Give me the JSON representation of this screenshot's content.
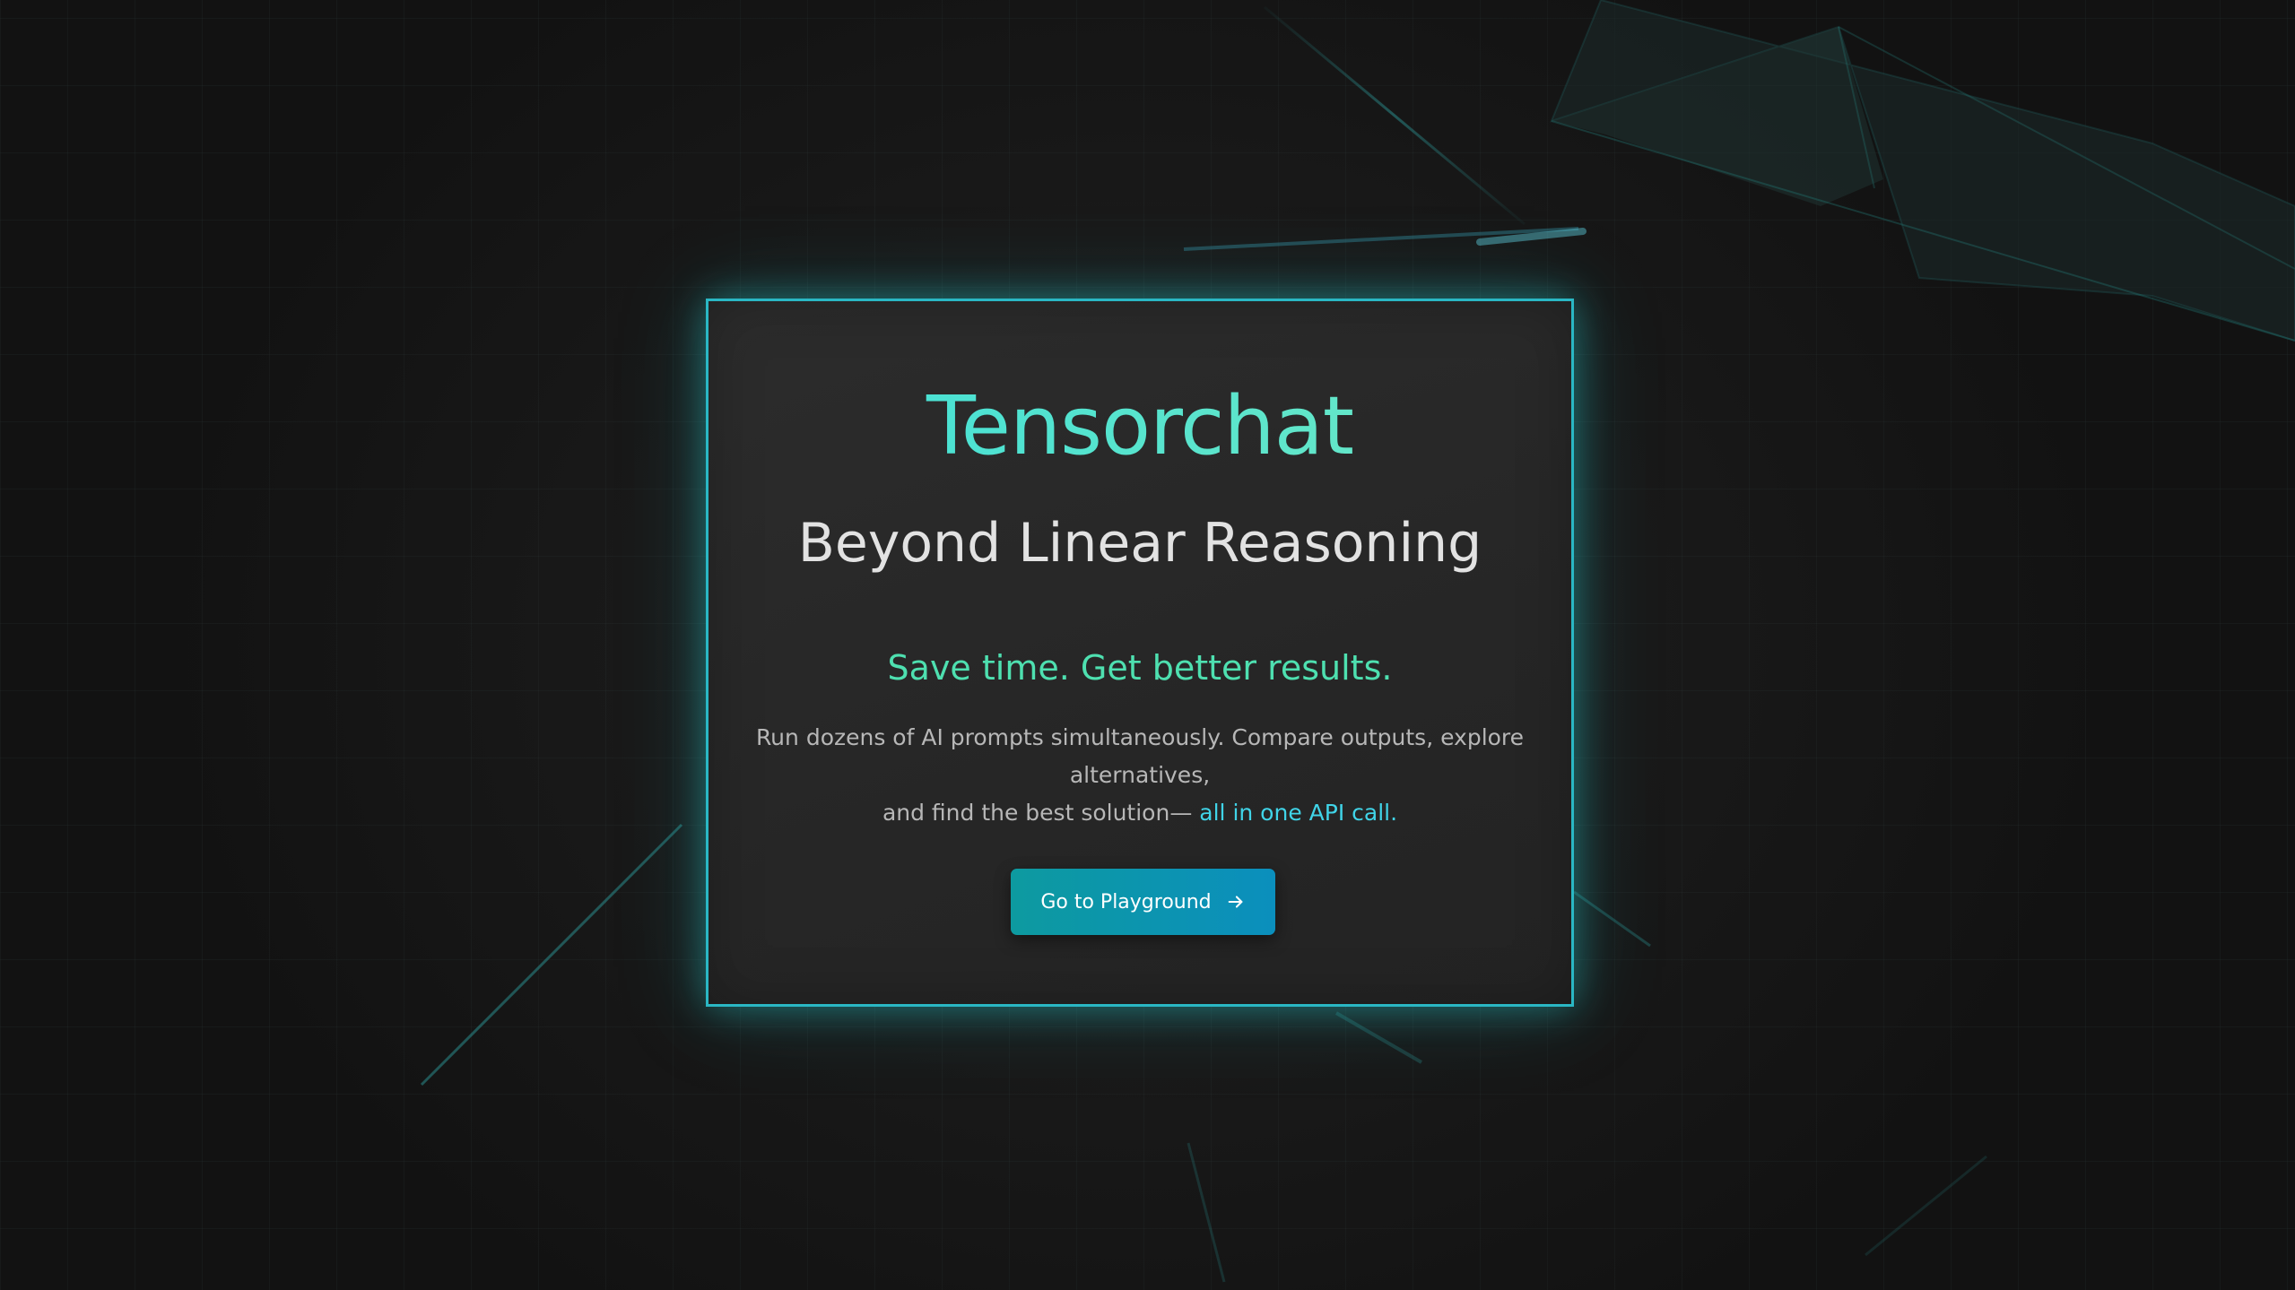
{
  "hero": {
    "brand": "Tensorchat",
    "headline": "Beyond Linear Reasoning",
    "tagline": "Save time. Get better results.",
    "description_line1": "Run dozens of AI prompts simultaneously. Compare outputs, explore alternatives,",
    "description_line2": "and find the best solution— ",
    "description_highlight": "all in one API call."
  },
  "cta": {
    "label": "Go to Playground",
    "icon": "arrow-right-icon"
  },
  "colors": {
    "background": "#141414",
    "card_border": "#2ab7c4",
    "brand": "#4fe0d0",
    "tagline": "#4ee0b0",
    "highlight": "#40d4e8",
    "button": "#0d9aa0"
  }
}
